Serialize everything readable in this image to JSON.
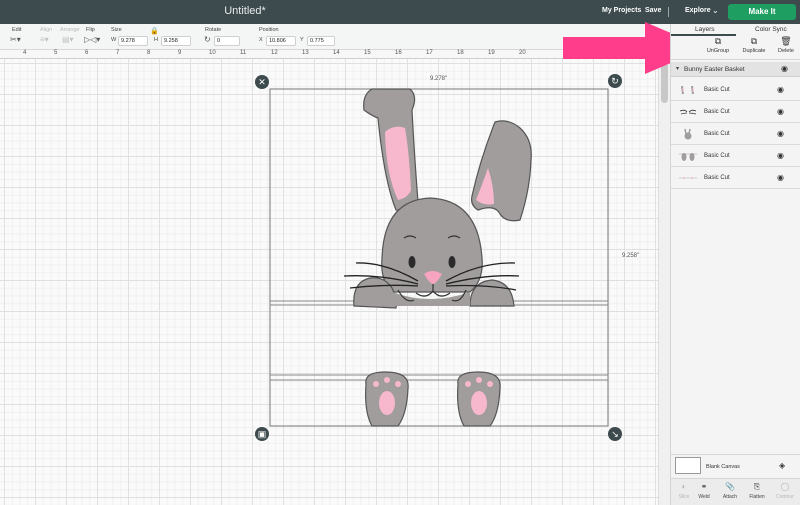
{
  "document": {
    "title": "Untitled*"
  },
  "nav": {
    "my_projects": "My Projects",
    "save": "Save",
    "explore": "Explore",
    "make_it": "Make It"
  },
  "toolbar": {
    "edit": "Edit",
    "align": "Align",
    "arrange": "Arrange",
    "flip": "Flip",
    "size": "Size",
    "w_prefix": "W",
    "width": "9.278",
    "h_prefix": "H",
    "height": "9.258",
    "rotate": "Rotate",
    "rotate_value": "0",
    "position": "Position",
    "x_prefix": "X",
    "x_value": "10.806",
    "y_prefix": "Y",
    "y_value": "0.775"
  },
  "ruler": {
    "marks": [
      "4",
      "5",
      "6",
      "7",
      "8",
      "9",
      "10",
      "11",
      "12",
      "13",
      "14",
      "15",
      "16",
      "17",
      "18",
      "19",
      "20"
    ]
  },
  "canvas": {
    "width_label": "9.278\"",
    "height_label": "9.258\""
  },
  "panel": {
    "tabs": {
      "layers": "Layers",
      "color_sync": "Color Sync"
    },
    "actions": {
      "ungroup": "UnGroup",
      "duplicate": "Duplicate",
      "delete": "Delete"
    },
    "group_name": "Bunny Easter Basket",
    "layers": [
      {
        "label": "Basic Cut",
        "thumb": "ears"
      },
      {
        "label": "Basic Cut",
        "thumb": "whiskers"
      },
      {
        "label": "Basic Cut",
        "thumb": "bunny"
      },
      {
        "label": "Basic Cut",
        "thumb": "paws"
      },
      {
        "label": "Basic Cut",
        "thumb": "dots"
      }
    ],
    "blank_canvas": "Blank Canvas",
    "bottom_actions": {
      "slice": "Slice",
      "weld": "Weld",
      "attach": "Attach",
      "flatten": "Flatten",
      "contour": "Contour"
    }
  },
  "colors": {
    "bunny_gray": "#a19d9d",
    "inner_pink": "#f7b7cd",
    "accent_green": "#1f9e62",
    "arrow_pink": "#ff3d8b"
  }
}
